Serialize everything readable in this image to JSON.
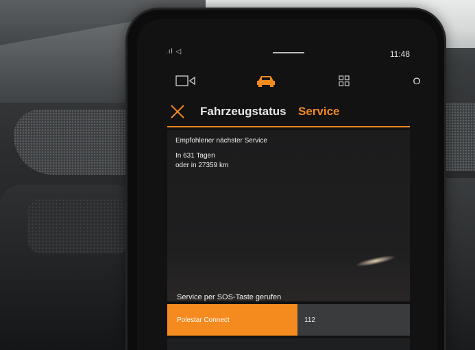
{
  "status_bar": {
    "signal": ".ıl ◁",
    "time": "11:48"
  },
  "nav": {
    "icons": [
      "camera-icon",
      "car-icon",
      "apps-grid-icon",
      "profile-icon"
    ],
    "profile_label": "O",
    "active_color": "#f58a1f"
  },
  "header": {
    "title": "Fahrzeugstatus",
    "active_tab": "Service"
  },
  "service": {
    "heading": "Empfohlener nächster Service",
    "days": "In 631 Tagen",
    "distance": "oder in 27359 km"
  },
  "sos": {
    "heading": "Service per SOS-Taste gerufen",
    "options": [
      {
        "label": "Polestar Connect",
        "selected": true
      },
      {
        "label": "112",
        "selected": false
      }
    ]
  },
  "colors": {
    "accent": "#f58a1f",
    "screen_bg": "#121213",
    "text": "#f0f0f0"
  }
}
